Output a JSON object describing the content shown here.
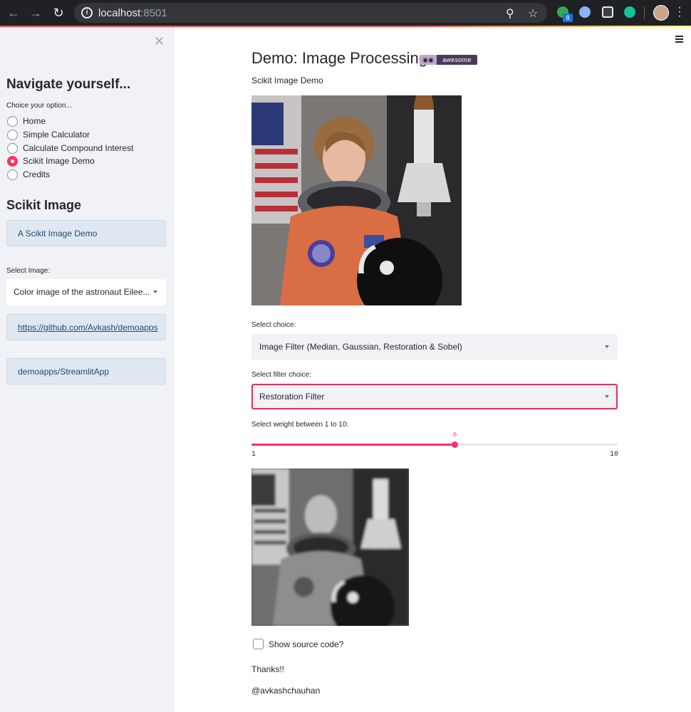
{
  "browser": {
    "url_host": "localhost",
    "url_port": ":8501",
    "extension_badge": "8"
  },
  "sidebar": {
    "nav_heading": "Navigate yourself...",
    "radio_label": "Choice your option...",
    "options": [
      {
        "label": "Home",
        "selected": false
      },
      {
        "label": "Simple Calculator",
        "selected": false
      },
      {
        "label": "Calculate Compound Interest",
        "selected": false
      },
      {
        "label": "Scikit Image Demo",
        "selected": true
      },
      {
        "label": "Credits",
        "selected": false
      }
    ],
    "section_heading": "Scikit Image",
    "info_text": "A Scikit Image Demo",
    "select_label": "Select Image:",
    "select_value": "Color image of the astronaut Eilee...",
    "link_text": "https://github.com/Avkash/demoapps",
    "repo_text": "demoapps/StreamlitApp"
  },
  "main": {
    "title": "Demo: Image Processing",
    "badge_text": "awesome",
    "subtitle": "Scikit Image Demo",
    "choice_label": "Select choice:",
    "choice_value": "Image Filter (Median, Gaussian, Restoration & Sobel)",
    "filter_label": "Select filter choice:",
    "filter_value": "Restoration Filter",
    "slider_label": "Select weight between 1 to 10:",
    "slider": {
      "min": 1,
      "max": 10,
      "value": 6
    },
    "slider_min_text": "1",
    "slider_max_text": "10",
    "slider_value_text": "6",
    "checkbox_label": "Show source code?",
    "thanks": "Thanks!!",
    "author": "@avkashchauhan"
  },
  "colors": {
    "accent": "#f63366",
    "sidebar_bg": "#f0f2f6",
    "info_bg": "#dfe8f1"
  }
}
